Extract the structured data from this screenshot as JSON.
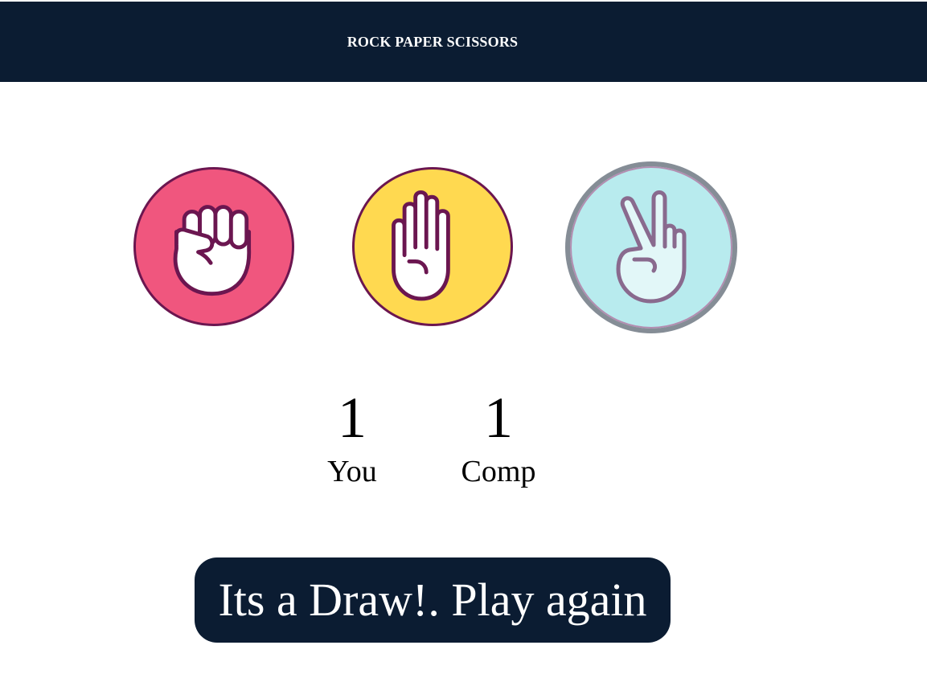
{
  "header": {
    "title": "ROCK PAPER SCISSORS"
  },
  "choices": [
    {
      "id": "rock",
      "icon": "fist-icon",
      "color": "#f0567e",
      "selected": false
    },
    {
      "id": "paper",
      "icon": "open-hand-icon",
      "color": "#ffd950",
      "selected": false
    },
    {
      "id": "scissors",
      "icon": "peace-sign-icon",
      "color": "#b8ebee",
      "selected": true
    }
  ],
  "scoreboard": {
    "user": {
      "score": "1",
      "label": "You"
    },
    "computer": {
      "score": "1",
      "label": "Comp"
    }
  },
  "result": {
    "message": "Its a Draw!. Play again"
  },
  "colors": {
    "header_bg": "#0b1c32",
    "outline": "#6b1650",
    "selected_ring": "#858d96"
  }
}
